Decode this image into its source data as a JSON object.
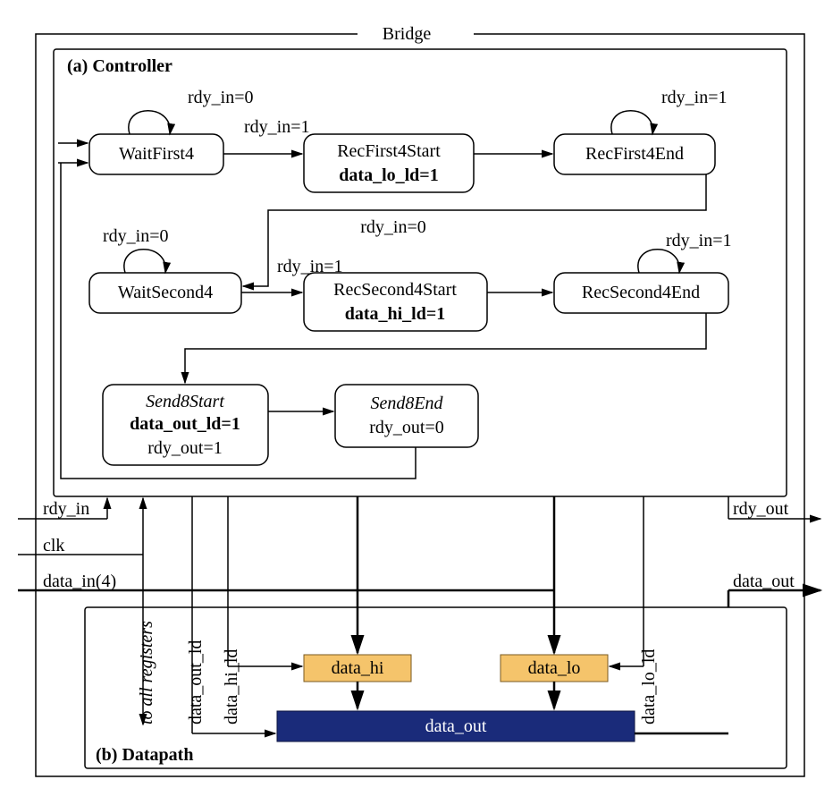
{
  "title": "Bridge",
  "controller": {
    "label": "(a) Controller",
    "states": {
      "waitFirst4": {
        "name": "WaitFirst4",
        "selfloop": "rdy_in=0",
        "out": "rdy_in=1"
      },
      "recFirst4Start": {
        "name": "RecFirst4Start",
        "action": "data_lo_ld=1"
      },
      "recFirst4End": {
        "name": "RecFirst4End",
        "selfloop": "rdy_in=1",
        "out": "rdy_in=0"
      },
      "waitSecond4": {
        "name": "WaitSecond4",
        "selfloop": "rdy_in=0",
        "out": "rdy_in=1"
      },
      "recSecond4Start": {
        "name": "RecSecond4Start",
        "action": "data_hi_ld=1"
      },
      "recSecond4End": {
        "name": "RecSecond4End",
        "selfloop": "rdy_in=1"
      },
      "send8Start": {
        "name": "Send8Start",
        "action1": "data_out_ld=1",
        "action2": "rdy_out=1"
      },
      "send8End": {
        "name": "Send8End",
        "action": "rdy_out=0"
      }
    }
  },
  "datapath": {
    "label": "(b) Datapath",
    "note": "to all registers",
    "regs": {
      "data_hi": "data_hi",
      "data_lo": "data_lo",
      "data_out": "data_out"
    }
  },
  "signals": {
    "rdy_in": "rdy_in",
    "clk": "clk",
    "data_in": "data_in(4)",
    "rdy_out": "rdy_out",
    "data_out": "data_out",
    "data_out_ld": "data_out_ld",
    "data_hi_ld": "data_hi_ld",
    "data_lo_ld": "data_lo_ld"
  }
}
